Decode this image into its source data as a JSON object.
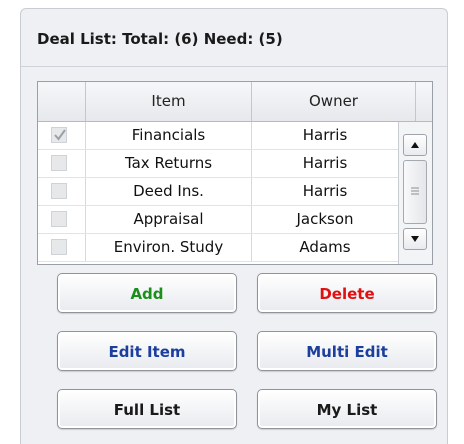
{
  "header": {
    "title": "Deal List: Total: (6) Need: (5)"
  },
  "table": {
    "columns": [
      "Item",
      "Owner"
    ],
    "rows": [
      {
        "item": "Financials",
        "owner": "Harris",
        "checked": true
      },
      {
        "item": "Tax Returns",
        "owner": "Harris",
        "checked": false
      },
      {
        "item": "Deed Ins.",
        "owner": "Harris",
        "checked": false
      },
      {
        "item": "Appraisal",
        "owner": "Jackson",
        "checked": false
      },
      {
        "item": "Environ. Study",
        "owner": "Adams",
        "checked": false
      }
    ]
  },
  "buttons": {
    "add": "Add",
    "delete": "Delete",
    "edit_item": "Edit Item",
    "multi_edit": "Multi Edit",
    "full_list": "Full List",
    "my_list": "My List"
  },
  "colors": {
    "add_text": "#1a8f1a",
    "delete_text": "#e01010",
    "edit_text": "#1c3f9e",
    "list_text": "#1a1a1a"
  },
  "icons": {
    "check": "check-icon",
    "scroll_up": "chevron-up-icon",
    "scroll_down": "chevron-down-icon",
    "grip": "scroll-grip-icon"
  }
}
